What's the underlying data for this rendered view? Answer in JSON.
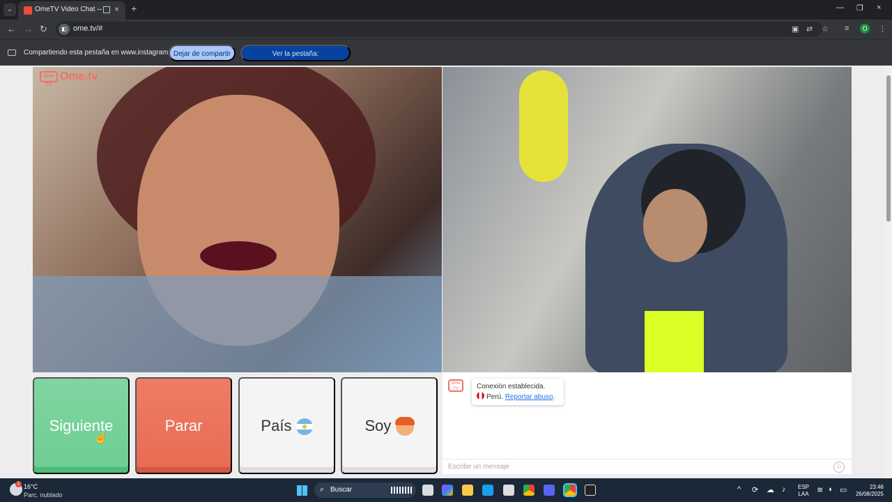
{
  "browser": {
    "tab_title": "OmeTV Video Chat — Ome",
    "url": "ome.tv/#",
    "profile_initial": "O",
    "sharebar": {
      "message": "Compartiendo esta pestaña en www.instagram.com",
      "stop_label": "Dejar de compartir",
      "view_label": "Ver la pestaña: www.instagram.com"
    }
  },
  "app": {
    "logo_text": "Ome.tv",
    "logo_badge": "Ome TV",
    "buttons": {
      "next": "Siguiente",
      "stop": "Parar",
      "country": "País",
      "gender": "Soy"
    },
    "chat": {
      "connection": "Conexión establecida.",
      "country": "Perú.",
      "report": "Reportar abuso",
      "placeholder": "Escribe un mensaje"
    }
  },
  "taskbar": {
    "temperature": "16°C",
    "weather": "Parc. nublado",
    "weather_badge": "1",
    "search_label": "Buscar",
    "lang_top": "ESP",
    "lang_bottom": "LAA",
    "time": "23:46",
    "date": "26/08/2025"
  },
  "colors": {
    "next": "#6ccd92",
    "stop": "#e86b53",
    "accent": "#1a73e8"
  }
}
